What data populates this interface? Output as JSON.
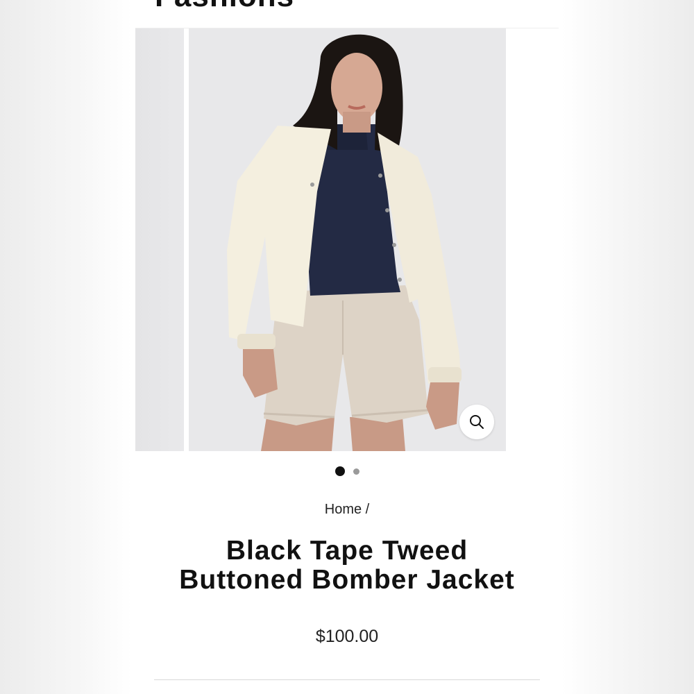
{
  "store": {
    "name": "Fashions"
  },
  "gallery": {
    "slide_count": 2,
    "active_slide": 1,
    "zoom_icon": "magnifier-icon"
  },
  "breadcrumb": {
    "home_label": "Home",
    "separator": "/"
  },
  "product": {
    "title_line1": "Black Tape Tweed",
    "title_line2": "Buttoned Bomber Jacket",
    "price": "$100.00"
  },
  "colors": {
    "jacket": "#f4efdf",
    "top": "#232a44",
    "shorts": "#ddd3c6",
    "backdrop": "#e8e8ea",
    "active_dot": "#111111",
    "inactive_dot": "#9a9a9a"
  }
}
